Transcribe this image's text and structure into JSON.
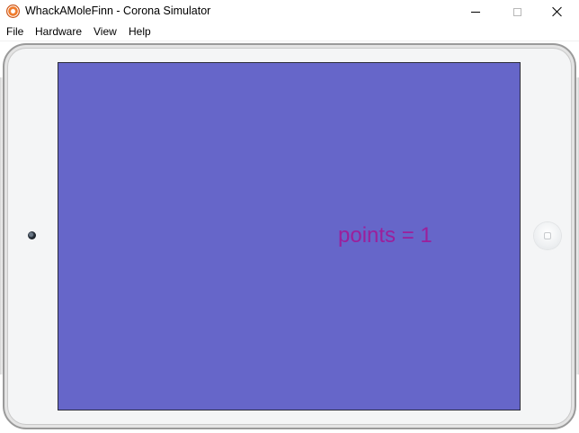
{
  "window": {
    "title": "WhackAMoleFinn - Corona Simulator",
    "app_icon": "corona-simulator-icon",
    "controls": {
      "minimize_icon": "minimize-icon",
      "maximize_icon": "maximize-icon",
      "close_icon": "close-icon"
    }
  },
  "menubar": {
    "items": [
      {
        "label": "File"
      },
      {
        "label": "Hardware"
      },
      {
        "label": "View"
      },
      {
        "label": "Help"
      }
    ]
  },
  "device": {
    "type": "tablet",
    "orientation": "landscape",
    "camera_icon": "camera-icon",
    "home_button_icon": "home-button-icon"
  },
  "screen": {
    "background_color": "#6666c9",
    "points_label": "points = 1",
    "points_color": "#9c1f9b"
  }
}
